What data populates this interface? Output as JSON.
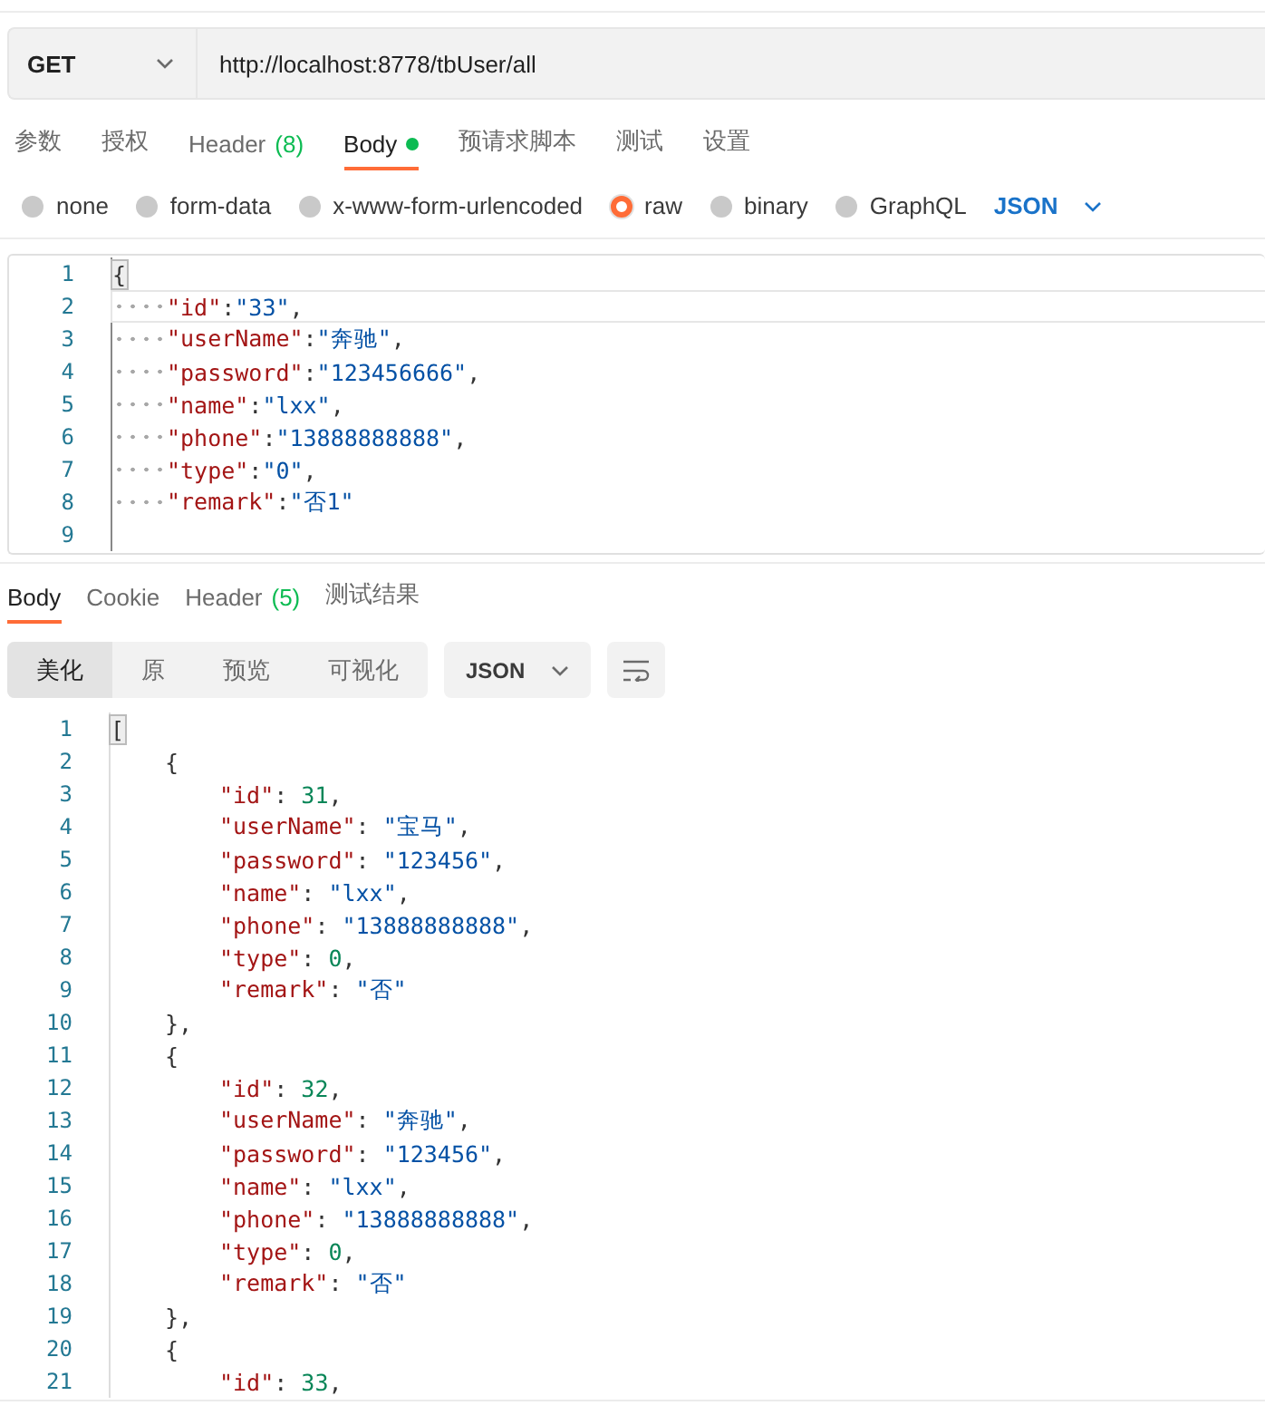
{
  "request": {
    "method": "GET",
    "url": "http://localhost:8778/tbUser/all"
  },
  "request_tabs": [
    {
      "label": "参数",
      "selected": false
    },
    {
      "label": "授权",
      "selected": false
    },
    {
      "label": "Header",
      "count": "(8)",
      "selected": false
    },
    {
      "label": "Body",
      "selected": true,
      "dot": true
    },
    {
      "label": "预请求脚本",
      "selected": false
    },
    {
      "label": "测试",
      "selected": false
    },
    {
      "label": "设置",
      "selected": false
    }
  ],
  "body_types": [
    {
      "label": "none",
      "selected": false
    },
    {
      "label": "form-data",
      "selected": false
    },
    {
      "label": "x-www-form-urlencoded",
      "selected": false
    },
    {
      "label": "raw",
      "selected": true
    },
    {
      "label": "binary",
      "selected": false
    },
    {
      "label": "GraphQL",
      "selected": false
    }
  ],
  "body_format": "JSON",
  "request_body": [
    {
      "number": "1",
      "active": false,
      "kind": "bracket",
      "tokens": [
        {
          "kind": "cursor",
          "text": "{"
        }
      ]
    },
    {
      "number": "2",
      "active": true,
      "kind": "field",
      "tokens": [
        {
          "kind": "key",
          "text": "\"id\""
        },
        {
          "kind": "punct",
          "text": ":"
        },
        {
          "kind": "string",
          "text": "\"33\""
        },
        {
          "kind": "punct",
          "text": ","
        }
      ]
    },
    {
      "number": "3",
      "active": false,
      "kind": "field",
      "tokens": [
        {
          "kind": "key",
          "text": "\"userName\""
        },
        {
          "kind": "punct",
          "text": ":"
        },
        {
          "kind": "string",
          "text": "\"奔驰\""
        },
        {
          "kind": "punct",
          "text": ","
        }
      ]
    },
    {
      "number": "4",
      "active": false,
      "kind": "field",
      "tokens": [
        {
          "kind": "key",
          "text": "\"password\""
        },
        {
          "kind": "punct",
          "text": ":"
        },
        {
          "kind": "string",
          "text": "\"123456666\""
        },
        {
          "kind": "punct",
          "text": ","
        }
      ]
    },
    {
      "number": "5",
      "active": false,
      "kind": "field",
      "tokens": [
        {
          "kind": "key",
          "text": "\"name\""
        },
        {
          "kind": "punct",
          "text": ":"
        },
        {
          "kind": "string",
          "text": "\"lxx\""
        },
        {
          "kind": "punct",
          "text": ","
        }
      ]
    },
    {
      "number": "6",
      "active": false,
      "kind": "field",
      "tokens": [
        {
          "kind": "key",
          "text": "\"phone\""
        },
        {
          "kind": "punct",
          "text": ":"
        },
        {
          "kind": "string",
          "text": "\"13888888888\""
        },
        {
          "kind": "punct",
          "text": ","
        }
      ]
    },
    {
      "number": "7",
      "active": false,
      "kind": "field",
      "tokens": [
        {
          "kind": "key",
          "text": "\"type\""
        },
        {
          "kind": "punct",
          "text": ":"
        },
        {
          "kind": "string",
          "text": "\"0\""
        },
        {
          "kind": "punct",
          "text": ","
        }
      ]
    },
    {
      "number": "8",
      "active": false,
      "kind": "field",
      "tokens": [
        {
          "kind": "key",
          "text": "\"remark\""
        },
        {
          "kind": "punct",
          "text": ":"
        },
        {
          "kind": "string",
          "text": "\"否1\""
        }
      ]
    },
    {
      "number": "9",
      "active": false,
      "kind": "blank"
    }
  ],
  "response_tabs": [
    {
      "label": "Body",
      "selected": true
    },
    {
      "label": "Cookie",
      "selected": false
    },
    {
      "label": "Header",
      "count": "(5)",
      "selected": false
    },
    {
      "label": "测试结果",
      "selected": false
    }
  ],
  "view_modes": [
    {
      "label": "美化",
      "selected": true
    },
    {
      "label": "原",
      "selected": false
    },
    {
      "label": "预览",
      "selected": false
    },
    {
      "label": "可视化",
      "selected": false
    }
  ],
  "response_format": "JSON",
  "response_body": [
    {
      "number": "1",
      "kind": "bracket",
      "tokens": [
        {
          "kind": "cursor",
          "text": "["
        }
      ]
    },
    {
      "number": "2",
      "kind": "brace",
      "tokens": [
        {
          "kind": "punct",
          "text": "{"
        }
      ]
    },
    {
      "number": "3",
      "kind": "field",
      "tokens": [
        {
          "kind": "key",
          "text": "\"id\""
        },
        {
          "kind": "punct",
          "text": ": "
        },
        {
          "kind": "number",
          "text": "31"
        },
        {
          "kind": "punct",
          "text": ","
        }
      ]
    },
    {
      "number": "4",
      "kind": "field",
      "tokens": [
        {
          "kind": "key",
          "text": "\"userName\""
        },
        {
          "kind": "punct",
          "text": ": "
        },
        {
          "kind": "string",
          "text": "\"宝马\""
        },
        {
          "kind": "punct",
          "text": ","
        }
      ]
    },
    {
      "number": "5",
      "kind": "field",
      "tokens": [
        {
          "kind": "key",
          "text": "\"password\""
        },
        {
          "kind": "punct",
          "text": ": "
        },
        {
          "kind": "string",
          "text": "\"123456\""
        },
        {
          "kind": "punct",
          "text": ","
        }
      ]
    },
    {
      "number": "6",
      "kind": "field",
      "tokens": [
        {
          "kind": "key",
          "text": "\"name\""
        },
        {
          "kind": "punct",
          "text": ": "
        },
        {
          "kind": "string",
          "text": "\"lxx\""
        },
        {
          "kind": "punct",
          "text": ","
        }
      ]
    },
    {
      "number": "7",
      "kind": "field",
      "tokens": [
        {
          "kind": "key",
          "text": "\"phone\""
        },
        {
          "kind": "punct",
          "text": ": "
        },
        {
          "kind": "string",
          "text": "\"13888888888\""
        },
        {
          "kind": "punct",
          "text": ","
        }
      ]
    },
    {
      "number": "8",
      "kind": "field",
      "tokens": [
        {
          "kind": "key",
          "text": "\"type\""
        },
        {
          "kind": "punct",
          "text": ": "
        },
        {
          "kind": "number",
          "text": "0"
        },
        {
          "kind": "punct",
          "text": ","
        }
      ]
    },
    {
      "number": "9",
      "kind": "field",
      "tokens": [
        {
          "kind": "key",
          "text": "\"remark\""
        },
        {
          "kind": "punct",
          "text": ": "
        },
        {
          "kind": "string",
          "text": "\"否\""
        }
      ]
    },
    {
      "number": "10",
      "kind": "brace",
      "tokens": [
        {
          "kind": "punct",
          "text": "},"
        }
      ]
    },
    {
      "number": "11",
      "kind": "brace",
      "tokens": [
        {
          "kind": "punct",
          "text": "{"
        }
      ]
    },
    {
      "number": "12",
      "kind": "field",
      "tokens": [
        {
          "kind": "key",
          "text": "\"id\""
        },
        {
          "kind": "punct",
          "text": ": "
        },
        {
          "kind": "number",
          "text": "32"
        },
        {
          "kind": "punct",
          "text": ","
        }
      ]
    },
    {
      "number": "13",
      "kind": "field",
      "tokens": [
        {
          "kind": "key",
          "text": "\"userName\""
        },
        {
          "kind": "punct",
          "text": ": "
        },
        {
          "kind": "string",
          "text": "\"奔驰\""
        },
        {
          "kind": "punct",
          "text": ","
        }
      ]
    },
    {
      "number": "14",
      "kind": "field",
      "tokens": [
        {
          "kind": "key",
          "text": "\"password\""
        },
        {
          "kind": "punct",
          "text": ": "
        },
        {
          "kind": "string",
          "text": "\"123456\""
        },
        {
          "kind": "punct",
          "text": ","
        }
      ]
    },
    {
      "number": "15",
      "kind": "field",
      "tokens": [
        {
          "kind": "key",
          "text": "\"name\""
        },
        {
          "kind": "punct",
          "text": ": "
        },
        {
          "kind": "string",
          "text": "\"lxx\""
        },
        {
          "kind": "punct",
          "text": ","
        }
      ]
    },
    {
      "number": "16",
      "kind": "field",
      "tokens": [
        {
          "kind": "key",
          "text": "\"phone\""
        },
        {
          "kind": "punct",
          "text": ": "
        },
        {
          "kind": "string",
          "text": "\"13888888888\""
        },
        {
          "kind": "punct",
          "text": ","
        }
      ]
    },
    {
      "number": "17",
      "kind": "field",
      "tokens": [
        {
          "kind": "key",
          "text": "\"type\""
        },
        {
          "kind": "punct",
          "text": ": "
        },
        {
          "kind": "number",
          "text": "0"
        },
        {
          "kind": "punct",
          "text": ","
        }
      ]
    },
    {
      "number": "18",
      "kind": "field",
      "tokens": [
        {
          "kind": "key",
          "text": "\"remark\""
        },
        {
          "kind": "punct",
          "text": ": "
        },
        {
          "kind": "string",
          "text": "\"否\""
        }
      ]
    },
    {
      "number": "19",
      "kind": "brace",
      "tokens": [
        {
          "kind": "punct",
          "text": "},"
        }
      ]
    },
    {
      "number": "20",
      "kind": "brace",
      "tokens": [
        {
          "kind": "punct",
          "text": "{"
        }
      ]
    },
    {
      "number": "21",
      "kind": "field",
      "tokens": [
        {
          "kind": "key",
          "text": "\"id\""
        },
        {
          "kind": "punct",
          "text": ": "
        },
        {
          "kind": "number",
          "text": "33"
        },
        {
          "kind": "punct",
          "text": ","
        }
      ]
    }
  ]
}
